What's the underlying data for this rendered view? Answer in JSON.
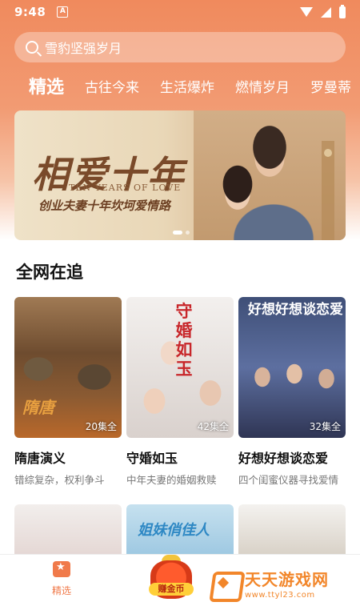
{
  "status_bar": {
    "time": "9:48",
    "notify_letter": "A"
  },
  "search": {
    "placeholder": "雪豹坚强岁月"
  },
  "tabs": [
    {
      "label": "精选",
      "active": true
    },
    {
      "label": "古往今来"
    },
    {
      "label": "生活爆炸"
    },
    {
      "label": "燃情岁月"
    },
    {
      "label": "罗曼蒂"
    }
  ],
  "banner": {
    "title": "相爱十年",
    "title_en": "TEN YEARS OF LOVE",
    "subtitle": "创业夫妻十年坎坷爱情路"
  },
  "section": {
    "title": "全网在追"
  },
  "cards": [
    {
      "poster_text": "隋唐",
      "badge": "20集全",
      "title": "隋唐演义",
      "desc": "错综复杂，权利争斗"
    },
    {
      "poster_text": "守婚如玉",
      "badge": "42集全",
      "title": "守婚如玉",
      "desc": "中年夫妻的婚姻救赎"
    },
    {
      "poster_text": "好想好想谈恋爱",
      "badge": "32集全",
      "title": "好想好想谈恋爱",
      "desc": "四个闺蜜仪器寻找爱情"
    }
  ],
  "row2": {
    "item2_text": "姐妹俏佳人"
  },
  "bottom_nav": {
    "home_label": "精选",
    "coin_label": "赚金币"
  },
  "watermark": {
    "cn": "天天游戏网",
    "url": "www.ttyl23.com"
  },
  "colors": {
    "accent": "#f07a4a",
    "header_top": "#f08a5d"
  }
}
